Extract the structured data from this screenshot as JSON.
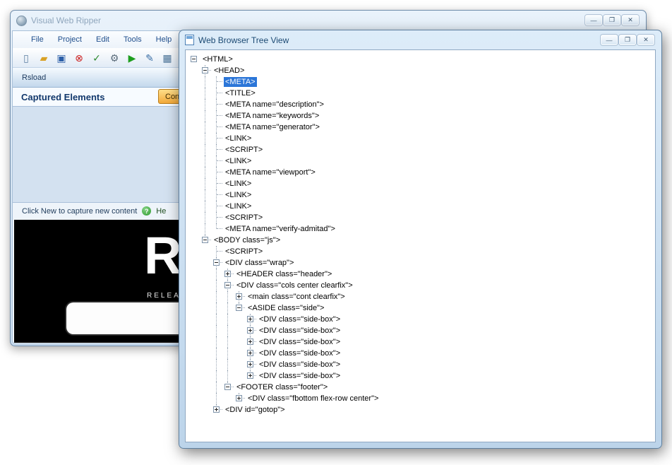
{
  "colors": {
    "selection_blue": "#2c76d8",
    "content_button_orange": "#f3a93a",
    "run_green": "#1e9e1e",
    "stop_red": "#cc2222"
  },
  "main_window": {
    "title": "Visual Web Ripper",
    "window_buttons": {
      "minimize": "—",
      "maximize": "❐",
      "close": "✕"
    },
    "menu": [
      {
        "label": "File"
      },
      {
        "label": "Project"
      },
      {
        "label": "Edit"
      },
      {
        "label": "Tools"
      },
      {
        "label": "Help"
      }
    ],
    "toolbar": [
      {
        "name": "new-document-icon",
        "glyph": "▯",
        "color": "#5b7da0"
      },
      {
        "name": "open-project-icon",
        "glyph": "▰",
        "color": "#d9a126"
      },
      {
        "name": "save-icon",
        "glyph": "▣",
        "color": "#2c5fa8"
      },
      {
        "name": "stop-icon",
        "glyph": "⊗",
        "color": "#cc2222"
      },
      {
        "name": "validate-list-icon",
        "glyph": "✓",
        "color": "#2e8b2e"
      },
      {
        "name": "options-gear-icon",
        "glyph": "⚙",
        "color": "#5a6b7a"
      },
      {
        "name": "run-icon",
        "glyph": "▶",
        "color": "#1e9e1e"
      },
      {
        "name": "edit-icon",
        "glyph": "✎",
        "color": "#3a6ea5"
      },
      {
        "name": "table-icon",
        "glyph": "▦",
        "color": "#4a7296"
      }
    ],
    "panel_tab": "Rsload",
    "captured": {
      "title": "Captured Elements",
      "button_label": "Cont"
    },
    "hint": {
      "text": "Click New to capture new content",
      "help_glyph": "?",
      "help_label": "He"
    },
    "preview": {
      "big_letter": "R",
      "caption": "RELEA"
    }
  },
  "tree_window": {
    "title": "Web Browser Tree View",
    "window_buttons": {
      "minimize": "—",
      "maximize": "❐",
      "close": "✕"
    }
  },
  "tree": {
    "items": [
      {
        "label": "<HTML>",
        "depth": 0,
        "expander": "minus"
      },
      {
        "label": "<HEAD>",
        "depth": 1,
        "expander": "minus"
      },
      {
        "label": "<META>",
        "depth": 2,
        "selected": true
      },
      {
        "label": "<TITLE>",
        "depth": 2
      },
      {
        "label": "<META name=\"description\">",
        "depth": 2
      },
      {
        "label": "<META name=\"keywords\">",
        "depth": 2
      },
      {
        "label": "<META name=\"generator\">",
        "depth": 2
      },
      {
        "label": "<LINK>",
        "depth": 2
      },
      {
        "label": "<SCRIPT>",
        "depth": 2
      },
      {
        "label": "<LINK>",
        "depth": 2
      },
      {
        "label": "<META name=\"viewport\">",
        "depth": 2
      },
      {
        "label": "<LINK>",
        "depth": 2
      },
      {
        "label": "<LINK>",
        "depth": 2
      },
      {
        "label": "<LINK>",
        "depth": 2
      },
      {
        "label": "<SCRIPT>",
        "depth": 2
      },
      {
        "label": "<META name=\"verify-admitad\">",
        "depth": 2
      },
      {
        "label": "<BODY class=\"js\">",
        "depth": 1,
        "expander": "minus"
      },
      {
        "label": "<SCRIPT>",
        "depth": 2
      },
      {
        "label": "<DIV class=\"wrap\">",
        "depth": 2,
        "expander": "minus"
      },
      {
        "label": "<HEADER class=\"header\">",
        "depth": 3,
        "expander": "plus"
      },
      {
        "label": "<DIV class=\"cols center clearfix\">",
        "depth": 3,
        "expander": "minus"
      },
      {
        "label": "<main class=\"cont clearfix\">",
        "depth": 4,
        "expander": "plus"
      },
      {
        "label": "<ASIDE class=\"side\">",
        "depth": 4,
        "expander": "minus"
      },
      {
        "label": "<DIV class=\"side-box\">",
        "depth": 5,
        "expander": "plus"
      },
      {
        "label": "<DIV class=\"side-box\">",
        "depth": 5,
        "expander": "plus"
      },
      {
        "label": "<DIV class=\"side-box\">",
        "depth": 5,
        "expander": "plus"
      },
      {
        "label": "<DIV class=\"side-box\">",
        "depth": 5,
        "expander": "plus"
      },
      {
        "label": "<DIV class=\"side-box\">",
        "depth": 5,
        "expander": "plus"
      },
      {
        "label": "<DIV class=\"side-box\">",
        "depth": 5,
        "expander": "plus"
      },
      {
        "label": "<FOOTER class=\"footer\">",
        "depth": 3,
        "expander": "minus"
      },
      {
        "label": "<DIV class=\"fbottom flex-row center\">",
        "depth": 4,
        "expander": "plus"
      },
      {
        "label": "<DIV id=\"gotop\">",
        "depth": 2,
        "expander": "plus"
      }
    ]
  }
}
